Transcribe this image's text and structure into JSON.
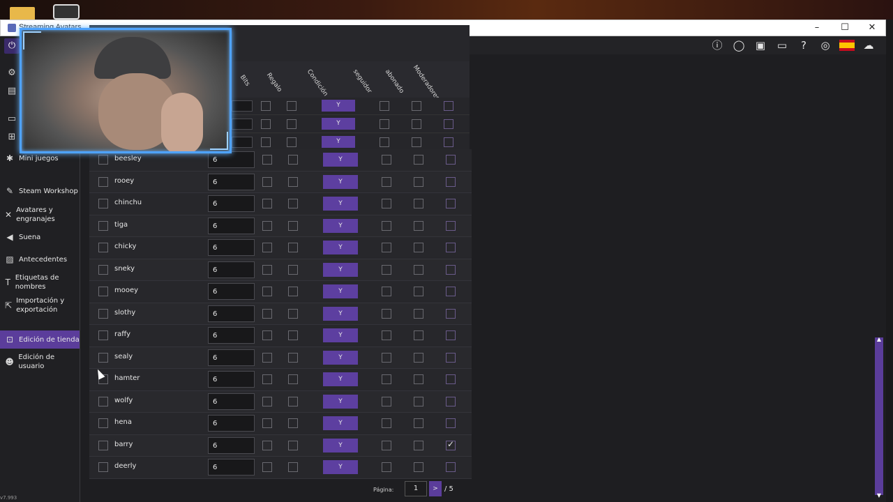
{
  "window": {
    "title": "Streaming Avatars",
    "minimize": "–",
    "maximize": "☐",
    "close": "✕"
  },
  "sidebar": {
    "items": [
      {
        "label": "Mini juegos",
        "icon": "gamepad-icon"
      },
      {
        "label": "Steam Workshop",
        "icon": "wrench-icon"
      },
      {
        "label": "Avatares y engranajes",
        "icon": "sword-icon"
      },
      {
        "label": "Suena",
        "icon": "speaker-icon"
      },
      {
        "label": "Antecedentes",
        "icon": "image-icon"
      },
      {
        "label": "Etiquetas de nombres",
        "icon": "text-icon"
      },
      {
        "label": "Importación y exportación",
        "icon": "export-icon"
      },
      {
        "label": "Edición de tienda",
        "icon": "cart-icon",
        "active": true
      },
      {
        "label": "Edición de usuario",
        "icon": "user-icon"
      }
    ],
    "version": "v7.993"
  },
  "table": {
    "columns": [
      "Bits",
      "Regalo",
      "Condición",
      "seguidor",
      "abonado",
      "Moderadores"
    ],
    "rows": [
      {
        "name": "beesley",
        "cost": "6",
        "condition": "Y",
        "moderadores": false
      },
      {
        "name": "rooey",
        "cost": "6",
        "condition": "Y",
        "moderadores": false
      },
      {
        "name": "chinchu",
        "cost": "6",
        "condition": "Y",
        "moderadores": false
      },
      {
        "name": "tiga",
        "cost": "6",
        "condition": "Y",
        "moderadores": false
      },
      {
        "name": "chicky",
        "cost": "6",
        "condition": "Y",
        "moderadores": false
      },
      {
        "name": "sneky",
        "cost": "6",
        "condition": "Y",
        "moderadores": false
      },
      {
        "name": "mooey",
        "cost": "6",
        "condition": "Y",
        "moderadores": false
      },
      {
        "name": "slothy",
        "cost": "6",
        "condition": "Y",
        "moderadores": false
      },
      {
        "name": "raffy",
        "cost": "6",
        "condition": "Y",
        "moderadores": false
      },
      {
        "name": "sealy",
        "cost": "6",
        "condition": "Y",
        "moderadores": false
      },
      {
        "name": "hamter",
        "cost": "6",
        "condition": "Y",
        "moderadores": false
      },
      {
        "name": "wolfy",
        "cost": "6",
        "condition": "Y",
        "moderadores": false
      },
      {
        "name": "hena",
        "cost": "6",
        "condition": "Y",
        "moderadores": false
      },
      {
        "name": "barry",
        "cost": "6",
        "condition": "Y",
        "moderadores": true
      },
      {
        "name": "deerly",
        "cost": "6",
        "condition": "Y",
        "moderadores": false
      }
    ],
    "partial_rows_condition": [
      "Y",
      "Y",
      "Y"
    ]
  },
  "pagination": {
    "label": "Página:",
    "current": "1",
    "next": ">",
    "total": "/ 5"
  },
  "colors": {
    "accent": "#5b3d9b",
    "background": "#1e1e21",
    "row": "#27272b"
  },
  "toolbar": {
    "icons": [
      "info-icon",
      "sync-icon",
      "save-icon",
      "folder-icon",
      "help-icon",
      "globe-icon",
      "spain-flag-icon",
      "cloud-icon"
    ]
  }
}
